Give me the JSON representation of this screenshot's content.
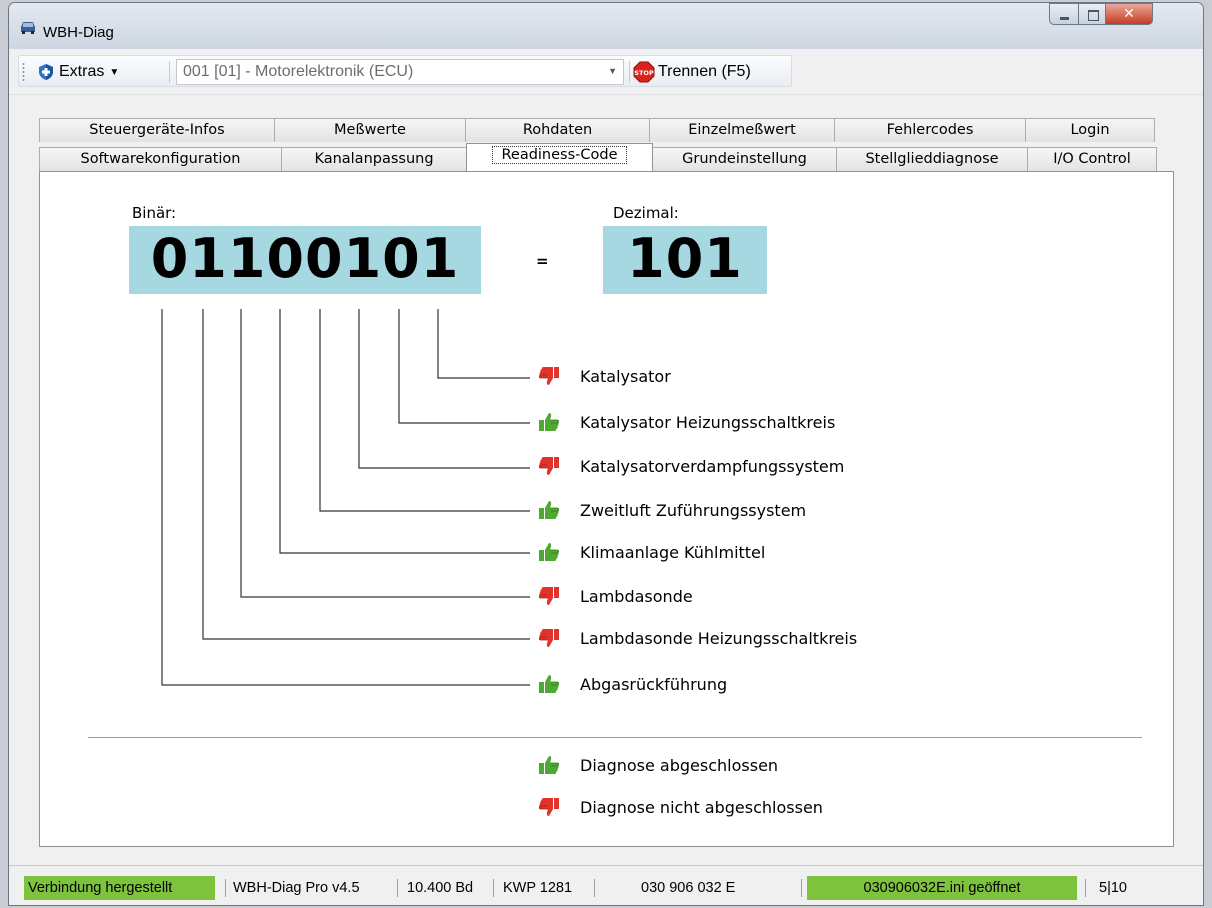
{
  "window": {
    "title": "WBH-Diag"
  },
  "toolbar": {
    "extras_label": "Extras",
    "ecu_value": "001 [01] - Motorelektronik (ECU)",
    "disconnect_label": "Trennen (F5)"
  },
  "tabs": {
    "row1": [
      "Steuergeräte-Infos",
      "Meßwerte",
      "Rohdaten",
      "Einzelmeßwert",
      "Fehlercodes",
      "Login"
    ],
    "row2": [
      "Softwarekonfiguration",
      "Kanalanpassung",
      "Readiness-Code",
      "Grundeinstellung",
      "Stellglieddiagnose",
      "I/O Control"
    ],
    "active": "Readiness-Code"
  },
  "readiness": {
    "binary_label": "Binär:",
    "binary_value": "01100101",
    "equals": "=",
    "decimal_label": "Dezimal:",
    "decimal_value": "101",
    "items": [
      {
        "label": "Katalysator",
        "status": "thumbs-down"
      },
      {
        "label": "Katalysator Heizungsschaltkreis",
        "status": "thumbs-up"
      },
      {
        "label": "Katalysatorverdampfungssystem",
        "status": "thumbs-down"
      },
      {
        "label": "Zweitluft Zuführungssystem",
        "status": "thumbs-up"
      },
      {
        "label": "Klimaanlage Kühlmittel",
        "status": "thumbs-up"
      },
      {
        "label": "Lambdasonde",
        "status": "thumbs-down"
      },
      {
        "label": "Lambdasonde Heizungsschaltkreis",
        "status": "thumbs-down"
      },
      {
        "label": "Abgasrückführung",
        "status": "thumbs-up"
      }
    ],
    "legend": [
      {
        "label": "Diagnose abgeschlossen",
        "status": "thumbs-up"
      },
      {
        "label": "Diagnose nicht abgeschlossen",
        "status": "thumbs-down"
      }
    ]
  },
  "statusbar": {
    "connection": "Verbindung hergestellt",
    "version": "WBH-Diag Pro v4.5",
    "baud": "10.400 Bd",
    "protocol": "KWP 1281",
    "part_number": "030 906 032 E",
    "file": "030906032E.ini geöffnet",
    "counter": "5|10"
  },
  "colors": {
    "number_box": "#a6d8e2",
    "status_green": "#7ec33e",
    "thumbs_up": "#4fa832",
    "thumbs_down": "#e0332c"
  }
}
